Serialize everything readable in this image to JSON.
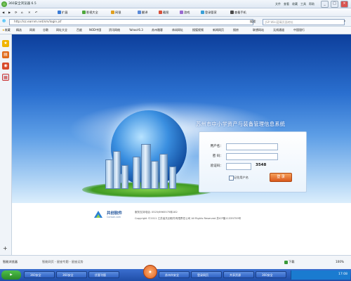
{
  "browser": {
    "title": "360安全浏览器 6.5",
    "title_menu": [
      "文件",
      "查看",
      "收藏",
      "工具",
      "帮助"
    ],
    "window_buttons": [
      "_",
      "□",
      "×"
    ],
    "toolbar": [
      "扩展",
      "影视大全",
      "网银",
      "翻译",
      "截图",
      "游戏",
      "登录管家",
      "查看手机"
    ],
    "address": "http://sz.earnm.net/sm/login.jsf",
    "go_label": "搜索",
    "search_placeholder": "JSP Wiki蓝莓页面地址",
    "favorites": [
      "收藏",
      "精选",
      "网易",
      "谷歌",
      "网址大全",
      "百度",
      "NOD中国",
      "资讯网络",
      "Yahoo!6.3",
      "苏州雅客",
      "休闲网址",
      "搜狐视频",
      "新闻网页",
      "搜房",
      "联想网站",
      "无线通道",
      "中国银行"
    ]
  },
  "sidebar": {
    "icons": [
      "star-icon",
      "folder-icon",
      "eye-icon",
      "calendar-icon"
    ],
    "add_label": "+"
  },
  "page": {
    "system_name": "苏州市中小学资产与装备管理信息系统",
    "login": {
      "username_label": "用户名：",
      "password_label": "密  码：",
      "captcha_label": "验证码：",
      "captcha_value": "3548",
      "remember_label": "记住用户名",
      "login_button": "登 录"
    },
    "footer": {
      "brand_cn": "共创软件",
      "brand_en": "Corsoe.com",
      "support": "服务支持电话: 0525/6965575转182",
      "copyright": "Copyright ©2011 江苏省共创软件有限责任公司 All Rights Reserved 苏ICP备11339759号"
    }
  },
  "status": {
    "left_text": "智能浏览器",
    "center_text": "智能网页 - 星座专题 - 星座运势",
    "right": [
      "下载",
      "100%"
    ]
  },
  "taskbar": {
    "items": [
      "360安全",
      "360安全",
      "优客刊版",
      "苏州市安全",
      "登录网页",
      "共享资源",
      "360安全"
    ],
    "time": "17:08"
  },
  "colors": {
    "banner_top": "#0d3f9c",
    "banner_bottom": "#dbeefc",
    "login_button": "#e0642a",
    "taskbar": "#2a5ab8"
  }
}
